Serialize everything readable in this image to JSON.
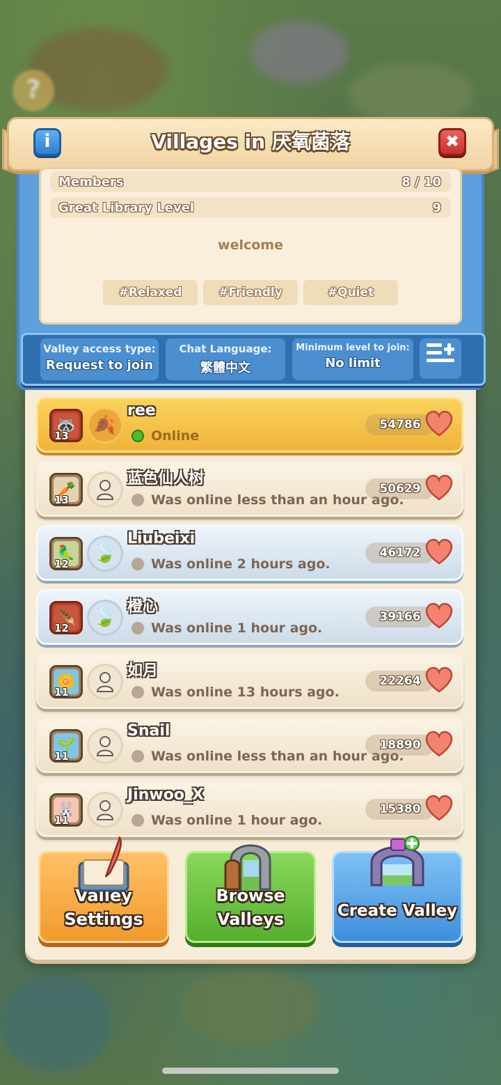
{
  "header": {
    "title": "Villages in 厌氧菌落",
    "info_icon": "i",
    "close_icon": "✖"
  },
  "stats": {
    "members_label": "Members",
    "members_value": "8 / 10",
    "library_label": "Great Library Level",
    "library_value": "9"
  },
  "welcome": "welcome",
  "tags": [
    "#Relaxed",
    "#Friendly",
    "#Quiet"
  ],
  "settings": {
    "access_label": "Valley access type:",
    "access_value": "Request to join",
    "language_label": "Chat Language:",
    "language_value": "繁體中文",
    "min_level_label": "Minimum level to join:",
    "min_level_value": "No limit",
    "filter_icon": "list-plus-icon"
  },
  "members": [
    {
      "name": "ree",
      "level": "13",
      "status": "Online",
      "score": "54786",
      "style": "gold",
      "online": true
    },
    {
      "name": "蓝色仙人树",
      "level": "13",
      "status": "Was online less than an hour ago.",
      "score": "50629",
      "style": "cream",
      "online": false
    },
    {
      "name": "Liubeixi",
      "level": "12",
      "status": "Was online 2 hours ago.",
      "score": "46172",
      "style": "silver",
      "online": false
    },
    {
      "name": "橙心",
      "level": "12",
      "status": "Was online 1 hour ago.",
      "score": "39166",
      "style": "silver",
      "online": false
    },
    {
      "name": "如月",
      "level": "11",
      "status": "Was online 13 hours ago.",
      "score": "22264",
      "style": "cream",
      "online": false
    },
    {
      "name": "Snail",
      "level": "11",
      "status": "Was online less than an hour ago.",
      "score": "18890",
      "style": "cream",
      "online": false
    },
    {
      "name": "Jinwoo_X",
      "level": "11",
      "status": "Was online 1 hour ago.",
      "score": "15380",
      "style": "cream",
      "online": false
    }
  ],
  "buttons": {
    "valley_settings_1": "Valley",
    "valley_settings_2": "Settings",
    "browse_valleys_1": "Browse",
    "browse_valleys_2": "Valleys",
    "create_valley": "Create Valley"
  },
  "colors": {
    "accent_blue": "#5ea0dd",
    "gold_row": "#f0b33a",
    "heart": "#f07a6a"
  }
}
